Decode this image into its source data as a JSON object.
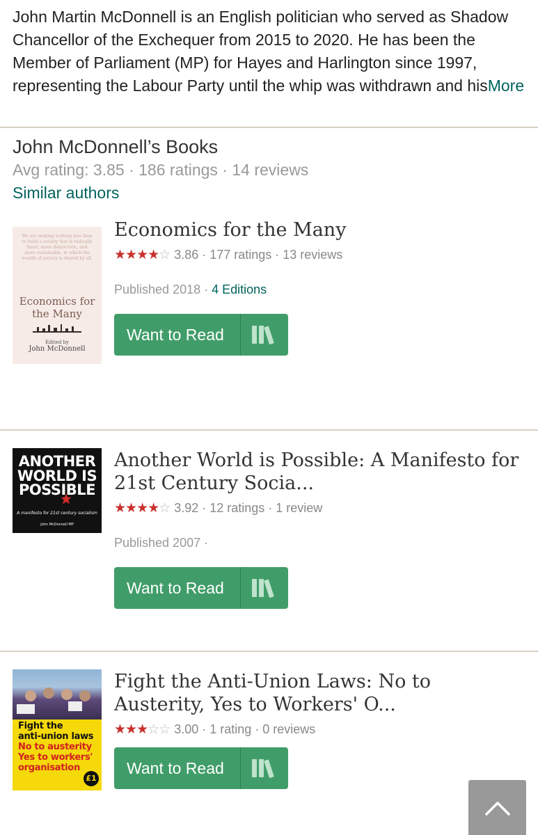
{
  "bio": {
    "text": "John Martin McDonnell is an English politician who served as Shadow Chancellor of the Exchequer from 2015 to 2020. He has been the Member of Parliament (MP) for Hayes and Harlington since 1997, representing the Labour Party until the whip was withdrawn and his",
    "more_label": "More"
  },
  "books_section": {
    "title": "John McDonnell’s Books",
    "stats": "Avg rating: 3.85 · 186 ratings · 14 reviews",
    "similar_label": "Similar authors"
  },
  "books": [
    {
      "title": "Economics for the Many",
      "rating": 3.86,
      "rating_text": "3.86 · 177 ratings · 13 reviews",
      "published": "Published 2018 · ",
      "editions": "4 Editions",
      "button_label": "Want to Read",
      "cover": {
        "blurb": "We are seeking nothing less than to build a society that is radically fairer, more democratic, and more sustainable, in which the wealth of society is shared by all.",
        "title_line1": "Economics for",
        "title_line2": "the Many",
        "edited_by": "Edited by",
        "editor": "John McDonnell"
      }
    },
    {
      "title": "Another World is Possible: A Manifesto for 21st Century Socia...",
      "rating": 3.92,
      "rating_text": "3.92 · 12 ratings · 1 review",
      "published": "Published 2007 ·",
      "editions": "",
      "button_label": "Want to Read",
      "cover": {
        "line1": "ANOTHER",
        "line2": "WORLD IS",
        "line3": "POSSIBLE",
        "subtitle": "A manifesto for 21st century socialism",
        "author": "John McDonnell MP"
      }
    },
    {
      "title": "Fight the Anti-Union Laws: No to Austerity, Yes to Workers' O...",
      "rating": 3.0,
      "rating_text": "3.00 · 1 rating · 0 reviews",
      "button_label": "Want to Read",
      "cover": {
        "line1": "Fight the",
        "line2": "anti-union laws",
        "line3": "No to austerity",
        "line4": "Yes to workers'",
        "line5": "organisation",
        "price": "£1"
      }
    }
  ],
  "colors": {
    "accent_green": "#409d69",
    "link_teal": "#00635d",
    "star_red": "#c9302c"
  }
}
